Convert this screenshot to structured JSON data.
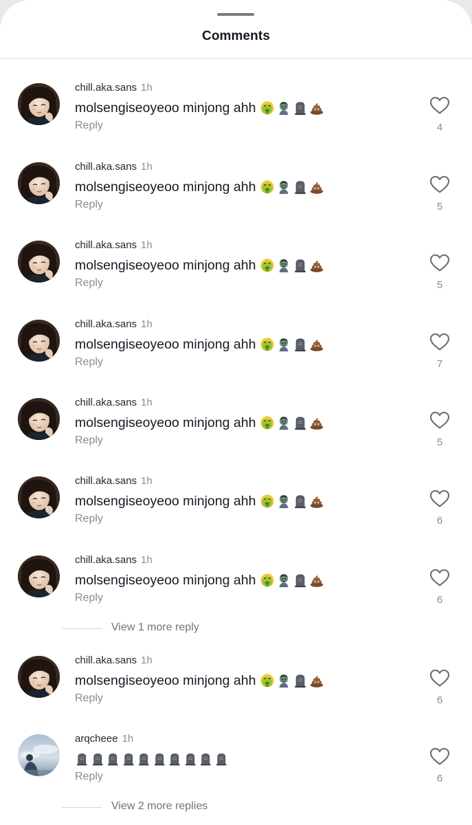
{
  "header": {
    "title": "Comments"
  },
  "comments": [
    {
      "username": "chill.aka.sans",
      "time": "1h",
      "text": "molsengiseoyeoo minjong ahh",
      "emojis": [
        "nauseated-face-emoji",
        "zombie-emoji",
        "headstone-emoji",
        "pile-of-poo-emoji"
      ],
      "reply_label": "Reply",
      "likes": "4",
      "avatar": "girl-avatar"
    },
    {
      "username": "chill.aka.sans",
      "time": "1h",
      "text": "molsengiseoyeoo minjong ahh",
      "emojis": [
        "nauseated-face-emoji",
        "zombie-emoji",
        "headstone-emoji",
        "pile-of-poo-emoji"
      ],
      "reply_label": "Reply",
      "likes": "5",
      "avatar": "girl-avatar"
    },
    {
      "username": "chill.aka.sans",
      "time": "1h",
      "text": "molsengiseoyeoo minjong ahh",
      "emojis": [
        "nauseated-face-emoji",
        "zombie-emoji",
        "headstone-emoji",
        "pile-of-poo-emoji"
      ],
      "reply_label": "Reply",
      "likes": "5",
      "avatar": "girl-avatar"
    },
    {
      "username": "chill.aka.sans",
      "time": "1h",
      "text": "molsengiseoyeoo minjong ahh",
      "emojis": [
        "nauseated-face-emoji",
        "zombie-emoji",
        "headstone-emoji",
        "pile-of-poo-emoji"
      ],
      "reply_label": "Reply",
      "likes": "7",
      "avatar": "girl-avatar"
    },
    {
      "username": "chill.aka.sans",
      "time": "1h",
      "text": "molsengiseoyeoo minjong ahh",
      "emojis": [
        "nauseated-face-emoji",
        "zombie-emoji",
        "headstone-emoji",
        "pile-of-poo-emoji"
      ],
      "reply_label": "Reply",
      "likes": "5",
      "avatar": "girl-avatar"
    },
    {
      "username": "chill.aka.sans",
      "time": "1h",
      "text": "molsengiseoyeoo minjong ahh",
      "emojis": [
        "nauseated-face-emoji",
        "zombie-emoji",
        "headstone-emoji",
        "pile-of-poo-emoji"
      ],
      "reply_label": "Reply",
      "likes": "6",
      "avatar": "girl-avatar"
    },
    {
      "username": "chill.aka.sans",
      "time": "1h",
      "text": "molsengiseoyeoo minjong ahh",
      "emojis": [
        "nauseated-face-emoji",
        "zombie-emoji",
        "headstone-emoji",
        "pile-of-poo-emoji"
      ],
      "reply_label": "Reply",
      "likes": "6",
      "avatar": "girl-avatar"
    },
    {
      "username": "chill.aka.sans",
      "time": "1h",
      "text": "molsengiseoyeoo minjong ahh",
      "emojis": [
        "nauseated-face-emoji",
        "zombie-emoji",
        "headstone-emoji",
        "pile-of-poo-emoji"
      ],
      "reply_label": "Reply",
      "likes": "6",
      "avatar": "girl-avatar"
    },
    {
      "username": "arqcheee",
      "time": "1h",
      "text": "",
      "emojis": [
        "headstone-emoji",
        "headstone-emoji",
        "headstone-emoji",
        "headstone-emoji",
        "headstone-emoji",
        "headstone-emoji",
        "headstone-emoji",
        "headstone-emoji",
        "headstone-emoji",
        "headstone-emoji"
      ],
      "reply_label": "Reply",
      "likes": "6",
      "avatar": "sky-photo-avatar"
    }
  ],
  "more_replies": [
    {
      "label": "View 1 more reply"
    },
    {
      "label": "View 2 more replies"
    }
  ],
  "colors": {
    "text": "#161823",
    "secondary": "#8a8b91",
    "background": "#ffffff"
  },
  "icons": {
    "like": "heart-outline-icon"
  }
}
